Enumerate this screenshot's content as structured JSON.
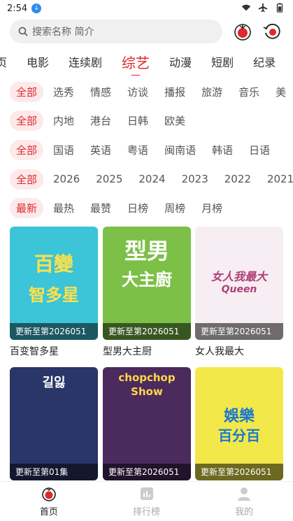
{
  "status": {
    "time": "2:54"
  },
  "search": {
    "placeholder": "搜索名称 简介"
  },
  "tabs": [
    "页",
    "电影",
    "连续剧",
    "综艺",
    "动漫",
    "短剧",
    "纪录"
  ],
  "filters": {
    "type": [
      "全部",
      "选秀",
      "情感",
      "访谈",
      "播报",
      "旅游",
      "音乐",
      "美"
    ],
    "region": [
      "全部",
      "内地",
      "港台",
      "日韩",
      "欧美"
    ],
    "language": [
      "全部",
      "国语",
      "英语",
      "粤语",
      "闽南语",
      "韩语",
      "日语"
    ],
    "year": [
      "全部",
      "2026",
      "2025",
      "2024",
      "2023",
      "2022",
      "2021"
    ],
    "sort": [
      "最新",
      "最热",
      "最赞",
      "日榜",
      "周榜",
      "月榜"
    ]
  },
  "cards": [
    {
      "title": "百变智多星",
      "update": "更新至第2026051",
      "art_top": "百變",
      "art_bottom": "智多星",
      "bg": "#3cc4d8",
      "color": "#ffe14a"
    },
    {
      "title": "型男大主厨",
      "update": "更新至第2026051",
      "art_top": "型男",
      "art_bottom": "大主廚",
      "bg": "#7cc048",
      "color": "#ffffff"
    },
    {
      "title": "女人我最大",
      "update": "更新至第2026051",
      "art_top": "女人我最大",
      "art_bottom": "Queen",
      "bg": "#f6eef2",
      "color": "#b0407a"
    },
    {
      "title": "",
      "update": "更新至第01集",
      "art_top": "길잃",
      "art_bottom": "",
      "bg": "#2a3568",
      "color": "#ffffff"
    },
    {
      "title": "",
      "update": "更新至第2026051",
      "art_top": "chopchop",
      "art_bottom": "Show",
      "bg": "#4b2a5e",
      "color": "#ffd84a"
    },
    {
      "title": "",
      "update": "更新至第2026051",
      "art_top": "娛樂",
      "art_bottom": "百分百",
      "bg": "#f2e84a",
      "color": "#1a78d0"
    }
  ],
  "nav": [
    "首页",
    "排行榜",
    "我的"
  ],
  "colors": {
    "accent": "#e0282e",
    "chip_bg": "#fde9ea"
  }
}
